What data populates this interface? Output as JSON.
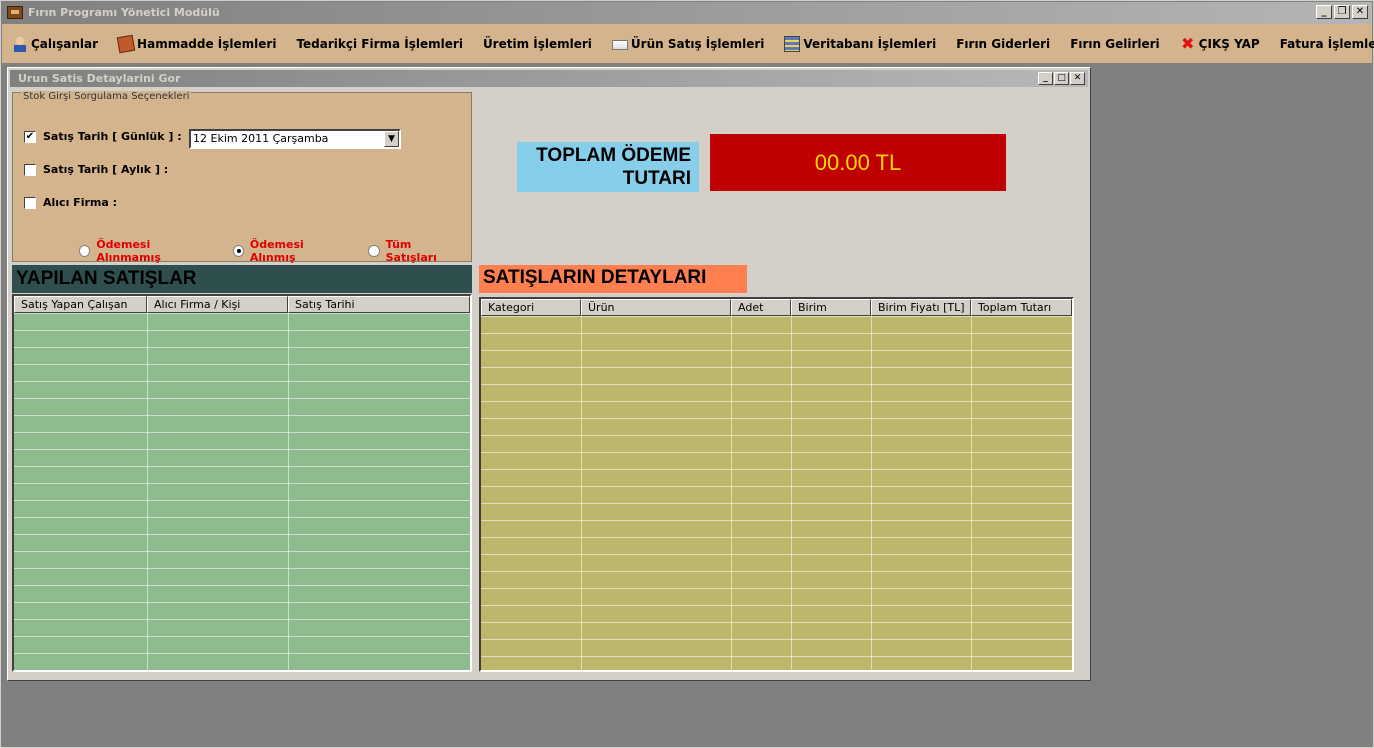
{
  "app": {
    "title": "Fırın Programı Yönetici Modülü"
  },
  "window_buttons": {
    "minimize": "_",
    "restore": "❐",
    "close": "✕"
  },
  "menu": [
    {
      "label": "Çalışanlar",
      "icon": "user-icon"
    },
    {
      "label": "Hammadde  İşlemleri",
      "icon": "box-icon"
    },
    {
      "label": "Tedarikçi Firma İşlemleri",
      "icon": ""
    },
    {
      "label": "Üretim İşlemleri",
      "icon": ""
    },
    {
      "label": "Ürün Satış İşlemleri",
      "icon": "printer-icon"
    },
    {
      "label": "Veritabanı İşlemleri",
      "icon": "database-icon"
    },
    {
      "label": "Fırın Giderleri",
      "icon": ""
    },
    {
      "label": "Fırın Gelirleri",
      "icon": ""
    },
    {
      "label": "ÇIKŞ YAP",
      "icon": "exit-icon"
    },
    {
      "label": "Fatura İşlemleri",
      "icon": ""
    }
  ],
  "child_window": {
    "title": "Urun Satis Detaylarini Gor",
    "groupbox": {
      "legend": "Stok Girşi Sorgulama Seçenekleri",
      "daily": {
        "label": "Satış Tarih [ Günlük ] :",
        "checked": true
      },
      "date_value": "12   Ekim    2011 Çarşamba",
      "monthly": {
        "label": "Satış Tarih [ Aylık ] :",
        "checked": false
      },
      "buyer": {
        "label": "Alıcı  Firma :",
        "checked": false
      },
      "radios": [
        {
          "label": "Ödemesi Alınmamış",
          "selected": false
        },
        {
          "label": "Ödemesi Alınmış",
          "selected": true
        },
        {
          "label": "Tüm Satışları",
          "selected": false
        }
      ]
    },
    "total": {
      "label_line1": "TOPLAM ÖDEME",
      "label_line2": "TUTARI",
      "value": "00.00 TL"
    },
    "sales_section": {
      "title": "YAPILAN SATIŞLAR",
      "columns": [
        "Satış Yapan Çalışan",
        "Alıcı Firma / Kişi",
        "Satış Tarihi"
      ]
    },
    "details_section": {
      "title": "SATIŞLARIN DETAYLARI",
      "columns": [
        "Kategori",
        "Ürün",
        "Adet",
        "Birim",
        "Birim Fiyatı [TL]",
        "Toplam Tutarı"
      ]
    },
    "colors": {
      "sales_grid": "#8fbc8f",
      "details_grid": "#bdb76b",
      "total_bg": "#c00000",
      "total_text": "#ffd700",
      "menubar": "#d4b48c"
    }
  }
}
